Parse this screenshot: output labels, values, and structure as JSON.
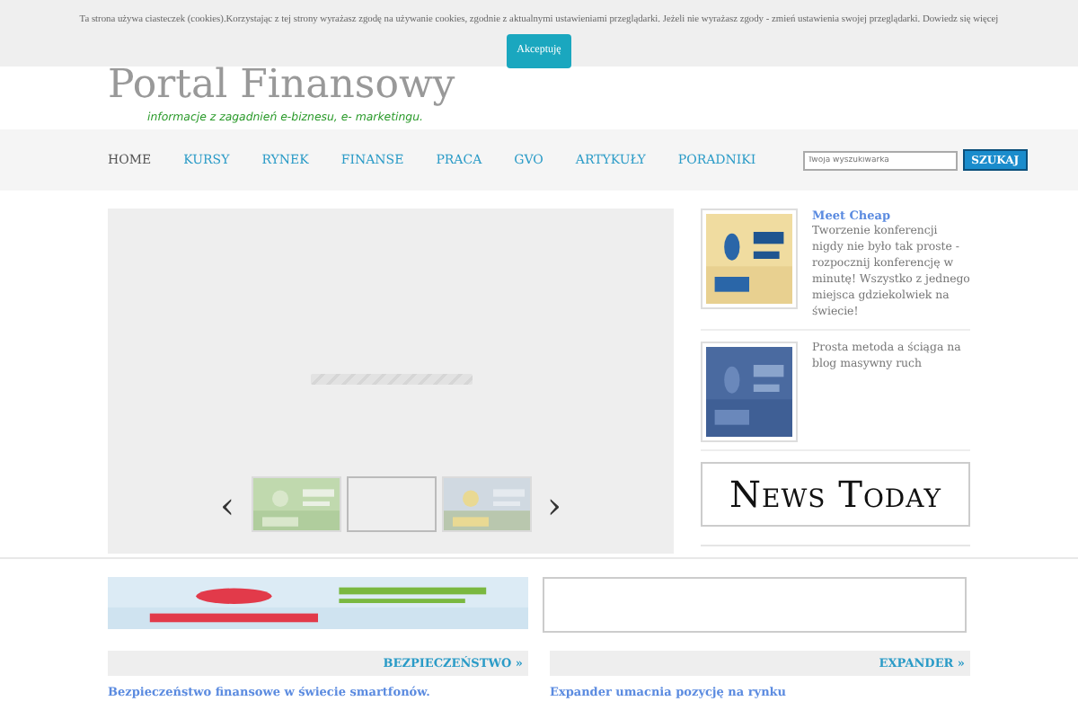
{
  "cookie_bar": {
    "message": "Ta strona używa ciasteczek (cookies).Korzystając z tej strony wyrażasz zgodę na używanie cookies, zgodnie z aktualnymi ustawieniami przeglądarki. Jeżeli nie wyrażasz zgody - zmień ustawienia swojej przeglądarki.",
    "link": "Dowiedz się więcej",
    "button": "Akceptuję"
  },
  "header": {
    "title": "Portal Finansowy",
    "tagline": "informacje z zagadnień e-biznesu, e- marketingu."
  },
  "nav": {
    "items": [
      {
        "label": "HOME",
        "selected": true
      },
      {
        "label": "KURSY",
        "selected": false
      },
      {
        "label": "RYNEK",
        "selected": false
      },
      {
        "label": "FINANSE",
        "selected": false
      },
      {
        "label": "PRACA",
        "selected": false
      },
      {
        "label": "GVO",
        "selected": false
      },
      {
        "label": "ARTYKUŁY",
        "selected": false
      },
      {
        "label": "PORADNIKI",
        "selected": false
      }
    ],
    "search": {
      "placeholder": "Twoja wyszukiwarka",
      "button": "SZUKAJ"
    }
  },
  "slider": {
    "prev": "‹",
    "next": "›",
    "thumbnails": [
      {
        "kind": "picture",
        "selected": false
      },
      {
        "kind": "blank",
        "selected": true
      },
      {
        "kind": "picture",
        "selected": false
      }
    ]
  },
  "sidebar": {
    "ads": [
      {
        "title": "Meet Cheap",
        "text": "Tworzenie konferencji nigdy nie było tak proste - rozpocznij konferencję w minutę! Wszystko z jednego miejsca gdziekolwiek na świecie!"
      },
      {
        "text": "Prosta metoda a ściąga na blog masywny ruch"
      }
    ],
    "logo": "News Today"
  },
  "sections": [
    {
      "heading": "BEZPIECZEŃSTWO »",
      "article": "Bezpieczeństwo finansowe w świecie smartfonów."
    },
    {
      "heading": "EXPANDER »",
      "article": "Expander umacnia pozycję na rynku"
    }
  ]
}
